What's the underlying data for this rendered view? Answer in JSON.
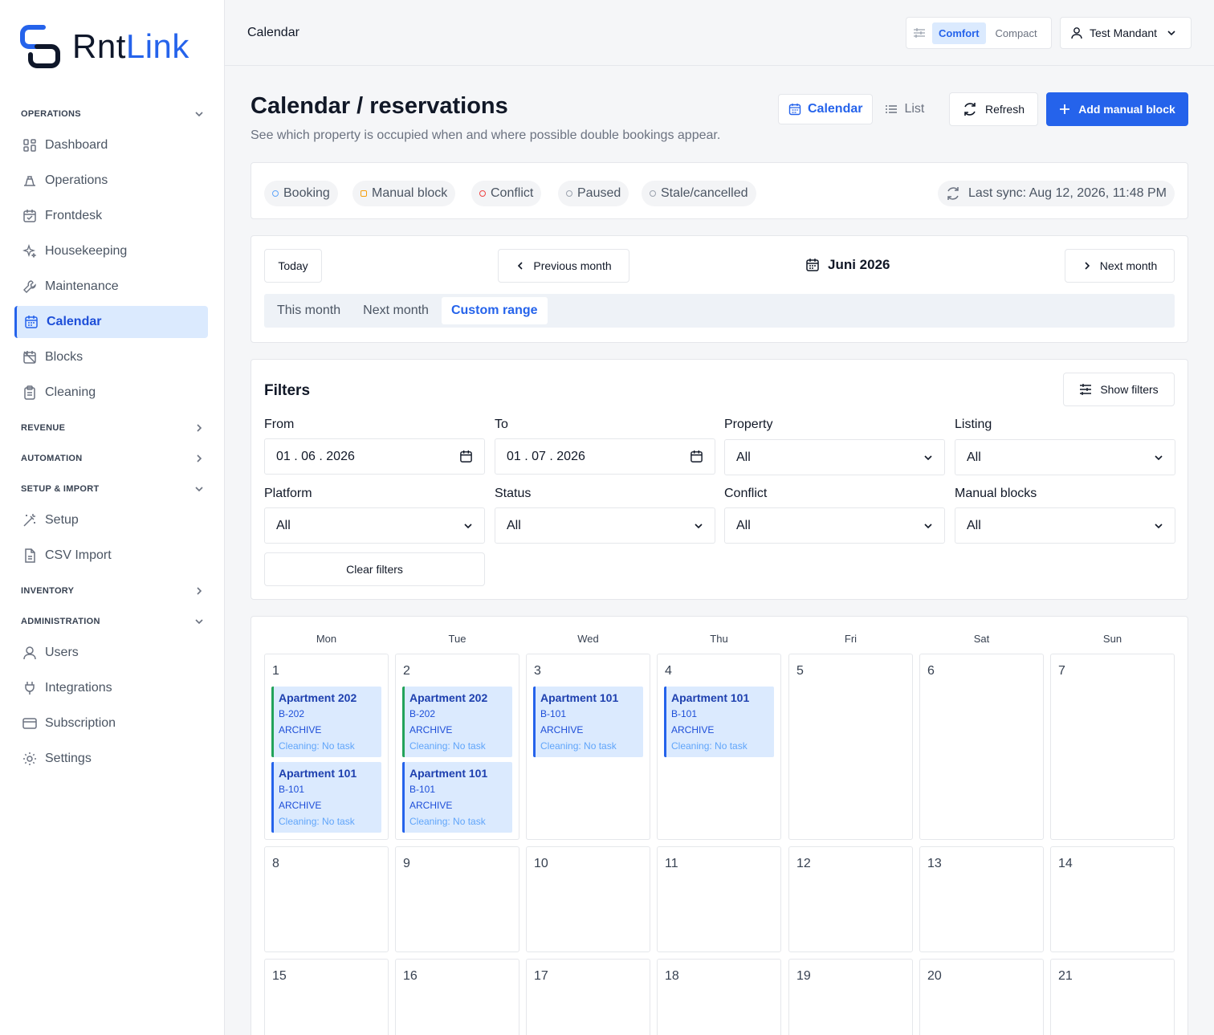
{
  "brand": {
    "name_a": "Rnt",
    "name_b": "Link"
  },
  "sidebar": {
    "sections": [
      {
        "label": "OPERATIONS",
        "state": "open"
      },
      {
        "label": "REVENUE",
        "state": "closed"
      },
      {
        "label": "AUTOMATION",
        "state": "closed"
      },
      {
        "label": "SETUP & IMPORT",
        "state": "open"
      },
      {
        "label": "INVENTORY",
        "state": "closed"
      },
      {
        "label": "ADMINISTRATION",
        "state": "open"
      }
    ],
    "items": [
      {
        "label": "Dashboard",
        "icon": "dashboard-icon"
      },
      {
        "label": "Operations",
        "icon": "operations-icon"
      },
      {
        "label": "Frontdesk",
        "icon": "frontdesk-icon"
      },
      {
        "label": "Housekeeping",
        "icon": "sparkle-icon"
      },
      {
        "label": "Maintenance",
        "icon": "wrench-icon"
      },
      {
        "label": "Calendar",
        "icon": "calendar-icon",
        "active": true
      },
      {
        "label": "Blocks",
        "icon": "calendar-off-icon"
      },
      {
        "label": "Cleaning",
        "icon": "clipboard-icon"
      },
      {
        "label": "Setup",
        "icon": "wand-icon"
      },
      {
        "label": "CSV Import",
        "icon": "file-icon"
      },
      {
        "label": "Users",
        "icon": "user-icon"
      },
      {
        "label": "Integrations",
        "icon": "plug-icon"
      },
      {
        "label": "Subscription",
        "icon": "card-icon"
      },
      {
        "label": "Settings",
        "icon": "gear-icon"
      }
    ]
  },
  "topbar": {
    "title": "Calendar",
    "density": [
      "Comfort",
      "Compact"
    ],
    "density_selected": "Comfort",
    "user": "Test Mandant"
  },
  "header": {
    "title": "Calendar / reservations",
    "subtitle": "See which property is occupied when and where possible double bookings appear.",
    "views": [
      "Calendar",
      "List"
    ],
    "view_selected": "Calendar",
    "refresh": "Refresh",
    "add": "Add manual block"
  },
  "legend": {
    "items": [
      {
        "label": "Booking",
        "color": "#60a5fa"
      },
      {
        "label": "Manual block",
        "color": "#f59e0b"
      },
      {
        "label": "Conflict",
        "color": "#ef4444"
      },
      {
        "label": "Paused",
        "color": "#9ca3af"
      },
      {
        "label": "Stale/cancelled",
        "color": "#9ca3af"
      }
    ],
    "sync": "Last sync: Aug 12, 2026, 11:48 PM"
  },
  "nav": {
    "today": "Today",
    "prev": "Previous month",
    "next": "Next month",
    "current": "Juni 2026",
    "ranges": [
      "This month",
      "Next month",
      "Custom range"
    ],
    "range_selected": "Custom range"
  },
  "filters": {
    "title": "Filters",
    "show": "Show filters",
    "clear": "Clear filters",
    "from": {
      "label": "From",
      "value": "01 . 06 . 2026"
    },
    "to": {
      "label": "To",
      "value": "01 . 07 . 2026"
    },
    "property": {
      "label": "Property",
      "value": "All"
    },
    "listing": {
      "label": "Listing",
      "value": "All"
    },
    "platform": {
      "label": "Platform",
      "value": "All"
    },
    "status": {
      "label": "Status",
      "value": "All"
    },
    "conflict": {
      "label": "Conflict",
      "value": "All"
    },
    "manual_blocks": {
      "label": "Manual blocks",
      "value": "All"
    }
  },
  "calendar": {
    "weekdays": [
      "Mon",
      "Tue",
      "Wed",
      "Thu",
      "Fri",
      "Sat",
      "Sun"
    ],
    "weeks": [
      [
        {
          "day": "1",
          "events": [
            {
              "title": "Apartment 202",
              "code": "B-202",
              "status": "ARCHIVE",
              "cleaning": "Cleaning: No task",
              "color": "green"
            },
            {
              "title": "Apartment 101",
              "code": "B-101",
              "status": "ARCHIVE",
              "cleaning": "Cleaning: No task",
              "color": "blue"
            }
          ]
        },
        {
          "day": "2",
          "events": [
            {
              "title": "Apartment 202",
              "code": "B-202",
              "status": "ARCHIVE",
              "cleaning": "Cleaning: No task",
              "color": "green"
            },
            {
              "title": "Apartment 101",
              "code": "B-101",
              "status": "ARCHIVE",
              "cleaning": "Cleaning: No task",
              "color": "blue"
            }
          ]
        },
        {
          "day": "3",
          "events": [
            {
              "title": "Apartment 101",
              "code": "B-101",
              "status": "ARCHIVE",
              "cleaning": "Cleaning: No task",
              "color": "blue"
            }
          ]
        },
        {
          "day": "4",
          "events": [
            {
              "title": "Apartment 101",
              "code": "B-101",
              "status": "ARCHIVE",
              "cleaning": "Cleaning: No task",
              "color": "blue"
            }
          ]
        },
        {
          "day": "5",
          "events": []
        },
        {
          "day": "6",
          "events": []
        },
        {
          "day": "7",
          "events": []
        }
      ],
      [
        {
          "day": "8",
          "events": []
        },
        {
          "day": "9",
          "events": []
        },
        {
          "day": "10",
          "events": []
        },
        {
          "day": "11",
          "events": []
        },
        {
          "day": "12",
          "events": []
        },
        {
          "day": "13",
          "events": []
        },
        {
          "day": "14",
          "events": []
        }
      ],
      [
        {
          "day": "15",
          "events": []
        },
        {
          "day": "16",
          "events": []
        },
        {
          "day": "17",
          "events": []
        },
        {
          "day": "18",
          "events": []
        },
        {
          "day": "19",
          "events": []
        },
        {
          "day": "20",
          "events": []
        },
        {
          "day": "21",
          "events": []
        }
      ]
    ]
  }
}
